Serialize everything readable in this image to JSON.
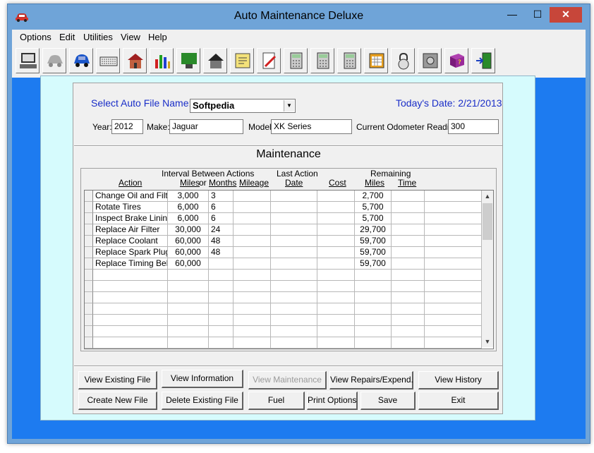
{
  "window": {
    "title": "Auto Maintenance Deluxe",
    "close_glyph": "✕",
    "min_glyph": "—",
    "max_glyph": "☐"
  },
  "menu": [
    {
      "label": "Options"
    },
    {
      "label": "Edit"
    },
    {
      "label": "Utilities"
    },
    {
      "label": "View"
    },
    {
      "label": "Help"
    }
  ],
  "toolbar": [
    {
      "icon": "computer-icon"
    },
    {
      "icon": "car-gray-icon"
    },
    {
      "icon": "car-blue-icon"
    },
    {
      "icon": "keyboard-icon"
    },
    {
      "icon": "house-icon"
    },
    {
      "icon": "bar-chart-icon"
    },
    {
      "icon": "map-icon"
    },
    {
      "icon": "home-dark-icon"
    },
    {
      "icon": "notepad-icon"
    },
    {
      "icon": "document-edit-icon"
    },
    {
      "icon": "calculator-icon"
    },
    {
      "icon": "calculator-icon"
    },
    {
      "icon": "calculator-icon"
    },
    {
      "icon": "calendar-icon"
    },
    {
      "icon": "padlock-icon"
    },
    {
      "icon": "safe-icon"
    },
    {
      "icon": "help-book-icon"
    },
    {
      "icon": "exit-door-icon"
    }
  ],
  "form": {
    "select_label": "Select Auto File Name:",
    "auto_file": "Softpedia",
    "date_label": "Today's Date: 2/21/2013",
    "year_label": "Year:",
    "year_value": "2012",
    "make_label": "Make:",
    "make_value": "Jaguar",
    "model_label": "Model:",
    "model_value": "XK Series",
    "odometer_label": "Current Odometer Reading:",
    "odometer_value": "300"
  },
  "maintenance": {
    "title": "Maintenance",
    "headers": {
      "interval_group": "Interval Between Actions",
      "last_action_group": "Last Action",
      "remaining_group": "Remaining",
      "action": "Action",
      "miles": "Miles",
      "or": "or",
      "months": "Months",
      "mileage": "Mileage",
      "date": "Date",
      "cost": "Cost",
      "rem_miles": "Miles",
      "time": "Time"
    },
    "rows": [
      {
        "action": "Change Oil and Filter",
        "miles": "3,000",
        "months": "3",
        "mileage": "",
        "date": "",
        "cost": "",
        "rem_miles": "2,700",
        "time": ""
      },
      {
        "action": "Rotate Tires",
        "miles": "6,000",
        "months": "6",
        "mileage": "",
        "date": "",
        "cost": "",
        "rem_miles": "5,700",
        "time": ""
      },
      {
        "action": "Inspect Brake Linings",
        "miles": "6,000",
        "months": "6",
        "mileage": "",
        "date": "",
        "cost": "",
        "rem_miles": "5,700",
        "time": ""
      },
      {
        "action": "Replace Air Filter",
        "miles": "30,000",
        "months": "24",
        "mileage": "",
        "date": "",
        "cost": "",
        "rem_miles": "29,700",
        "time": ""
      },
      {
        "action": "Replace Coolant",
        "miles": "60,000",
        "months": "48",
        "mileage": "",
        "date": "",
        "cost": "",
        "rem_miles": "59,700",
        "time": ""
      },
      {
        "action": "Replace Spark Plugs",
        "miles": "60,000",
        "months": "48",
        "mileage": "",
        "date": "",
        "cost": "",
        "rem_miles": "59,700",
        "time": ""
      },
      {
        "action": "Replace Timing Belt",
        "miles": "60,000",
        "months": "",
        "mileage": "",
        "date": "",
        "cost": "",
        "rem_miles": "59,700",
        "time": ""
      },
      {
        "action": "",
        "miles": "",
        "months": "",
        "mileage": "",
        "date": "",
        "cost": "",
        "rem_miles": "",
        "time": ""
      },
      {
        "action": "",
        "miles": "",
        "months": "",
        "mileage": "",
        "date": "",
        "cost": "",
        "rem_miles": "",
        "time": ""
      },
      {
        "action": "",
        "miles": "",
        "months": "",
        "mileage": "",
        "date": "",
        "cost": "",
        "rem_miles": "",
        "time": ""
      },
      {
        "action": "",
        "miles": "",
        "months": "",
        "mileage": "",
        "date": "",
        "cost": "",
        "rem_miles": "",
        "time": ""
      },
      {
        "action": "",
        "miles": "",
        "months": "",
        "mileage": "",
        "date": "",
        "cost": "",
        "rem_miles": "",
        "time": ""
      },
      {
        "action": "",
        "miles": "",
        "months": "",
        "mileage": "",
        "date": "",
        "cost": "",
        "rem_miles": "",
        "time": ""
      },
      {
        "action": "",
        "miles": "",
        "months": "",
        "mileage": "",
        "date": "",
        "cost": "",
        "rem_miles": "",
        "time": ""
      }
    ]
  },
  "buttons": {
    "view_existing": "View Existing File",
    "view_information": "View Information",
    "view_maintenance": "View Maintenance",
    "view_repairs": "View Repairs/Expend.",
    "view_history": "View History",
    "create_new": "Create New File",
    "delete_existing": "Delete Existing File",
    "fuel": "Fuel",
    "print_options": "Print Options",
    "save": "Save",
    "exit": "Exit"
  },
  "colors": {
    "title_bar": "#6fa4d8",
    "client_bg": "#1d7bf0",
    "panel_bg": "#d6fbfd",
    "label_blue": "#1a2ec8",
    "close_red": "#c7463a"
  }
}
